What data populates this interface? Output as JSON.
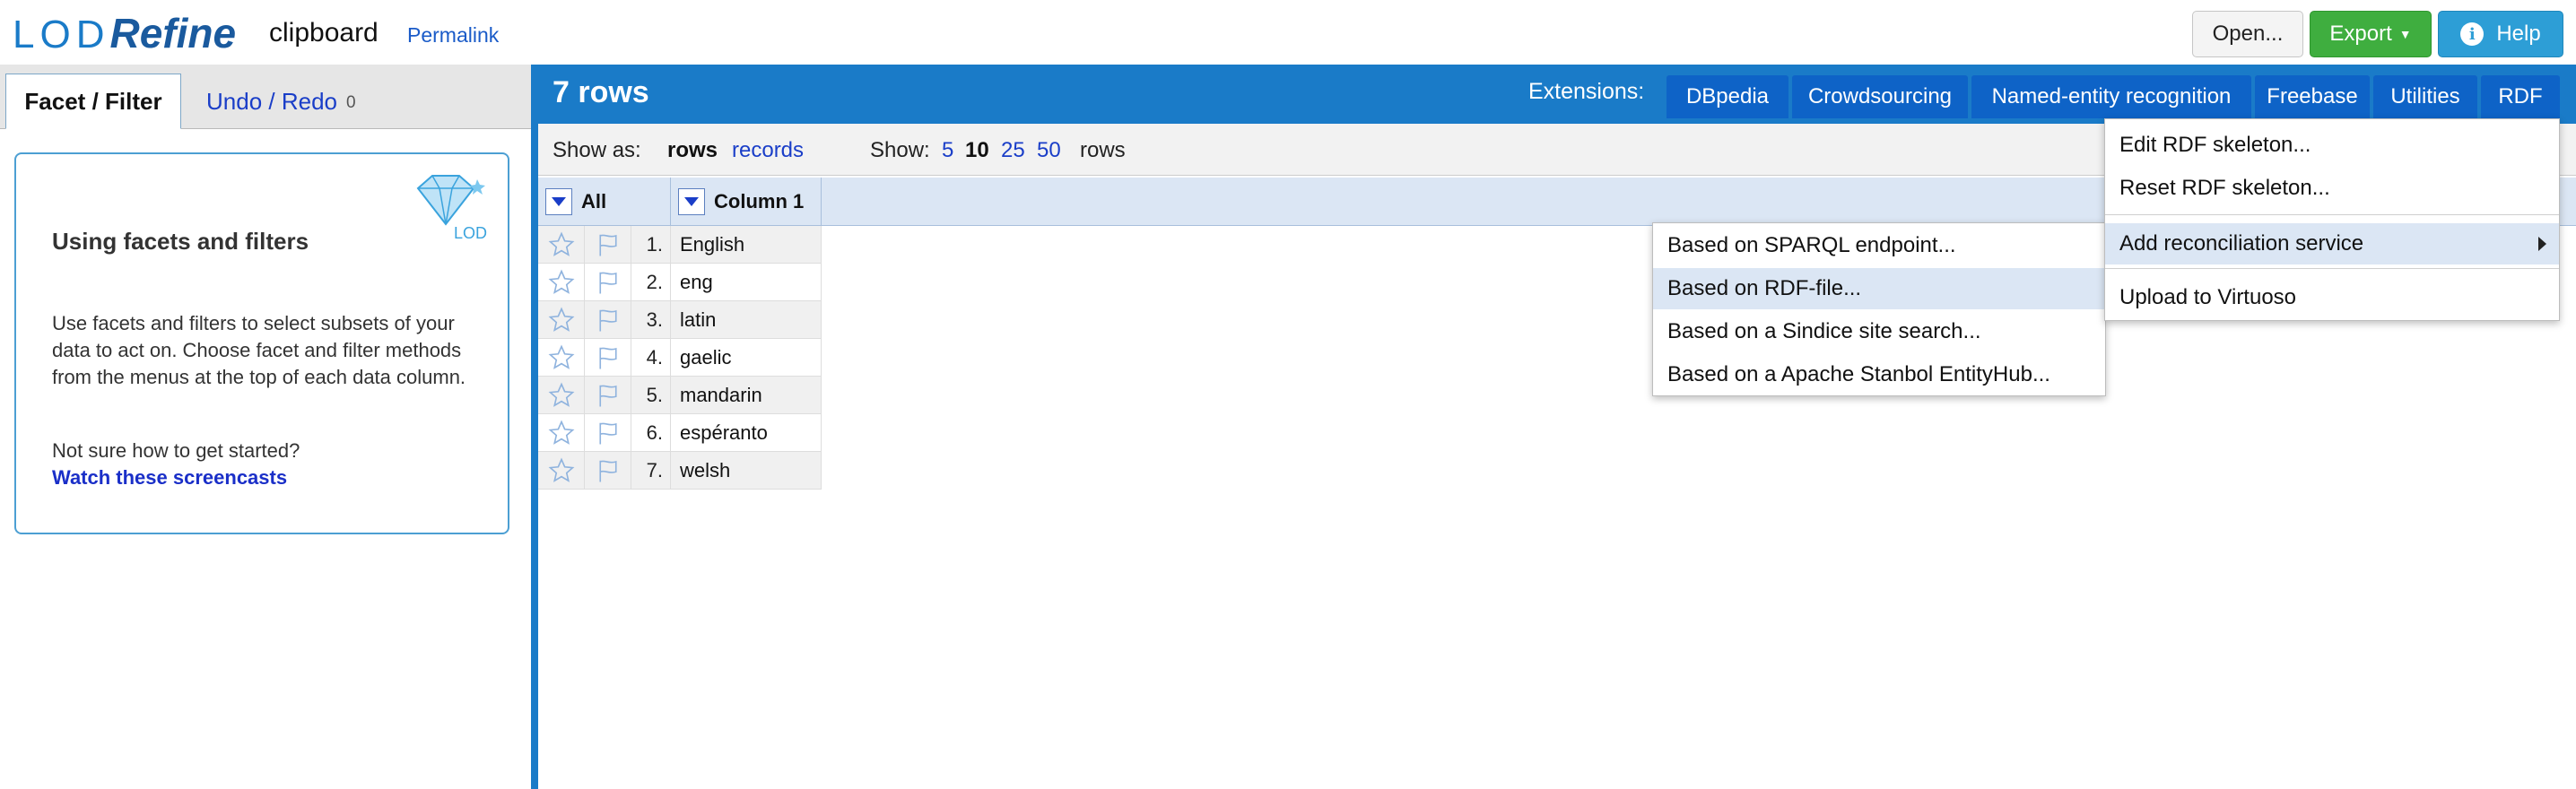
{
  "header": {
    "logo_lod": "LOD",
    "logo_refine": "Refine",
    "project_name": "clipboard",
    "permalink": "Permalink",
    "open_label": "Open...",
    "export_label": "Export",
    "help_label": "Help"
  },
  "left_panel": {
    "tabs": [
      {
        "label": "Facet / Filter"
      },
      {
        "label": "Undo / Redo",
        "count": "0"
      }
    ],
    "help": {
      "title": "Using facets and filters",
      "body": "Use facets and filters to select subsets of your data to act on. Choose facet and filter methods from the menus at the top of each data column.",
      "question": "Not sure how to get started?",
      "link": "Watch these screencasts",
      "badge": "LOD"
    }
  },
  "grid": {
    "row_count": "7 rows",
    "extensions_label": "Extensions:",
    "extensions": [
      "DBpedia",
      "Crowdsourcing",
      "Named-entity recognition",
      "Freebase",
      "Utilities",
      "RDF"
    ],
    "show_as_label": "Show as:",
    "show_as_rows": "rows",
    "show_as_records": "records",
    "show_label": "Show:",
    "page_sizes": [
      "5",
      "10",
      "25",
      "50"
    ],
    "selected_page_size": "10",
    "rows_suffix": "rows",
    "columns": [
      "All",
      "Column 1"
    ],
    "rows": [
      {
        "num": "1.",
        "value": "English"
      },
      {
        "num": "2.",
        "value": "eng"
      },
      {
        "num": "3.",
        "value": "latin"
      },
      {
        "num": "4.",
        "value": "gaelic"
      },
      {
        "num": "5.",
        "value": "mandarin"
      },
      {
        "num": "6.",
        "value": "espéranto"
      },
      {
        "num": "7.",
        "value": "welsh"
      }
    ]
  },
  "rdf_menu": {
    "items": [
      "Edit RDF skeleton...",
      "Reset RDF skeleton...",
      "Add reconciliation service",
      "Upload to Virtuoso"
    ]
  },
  "recon_submenu": {
    "items": [
      "Based on SPARQL endpoint...",
      "Based on RDF-file...",
      "Based on a Sindice site search...",
      "Based on a Apache Stanbol EntityHub..."
    ]
  },
  "colors": {
    "brand_blue": "#1a7bc8",
    "extension_button": "#0e63c7",
    "export_green": "#3fae3f",
    "help_blue": "#2d9ed6",
    "highlight": "#dbe6f4"
  }
}
